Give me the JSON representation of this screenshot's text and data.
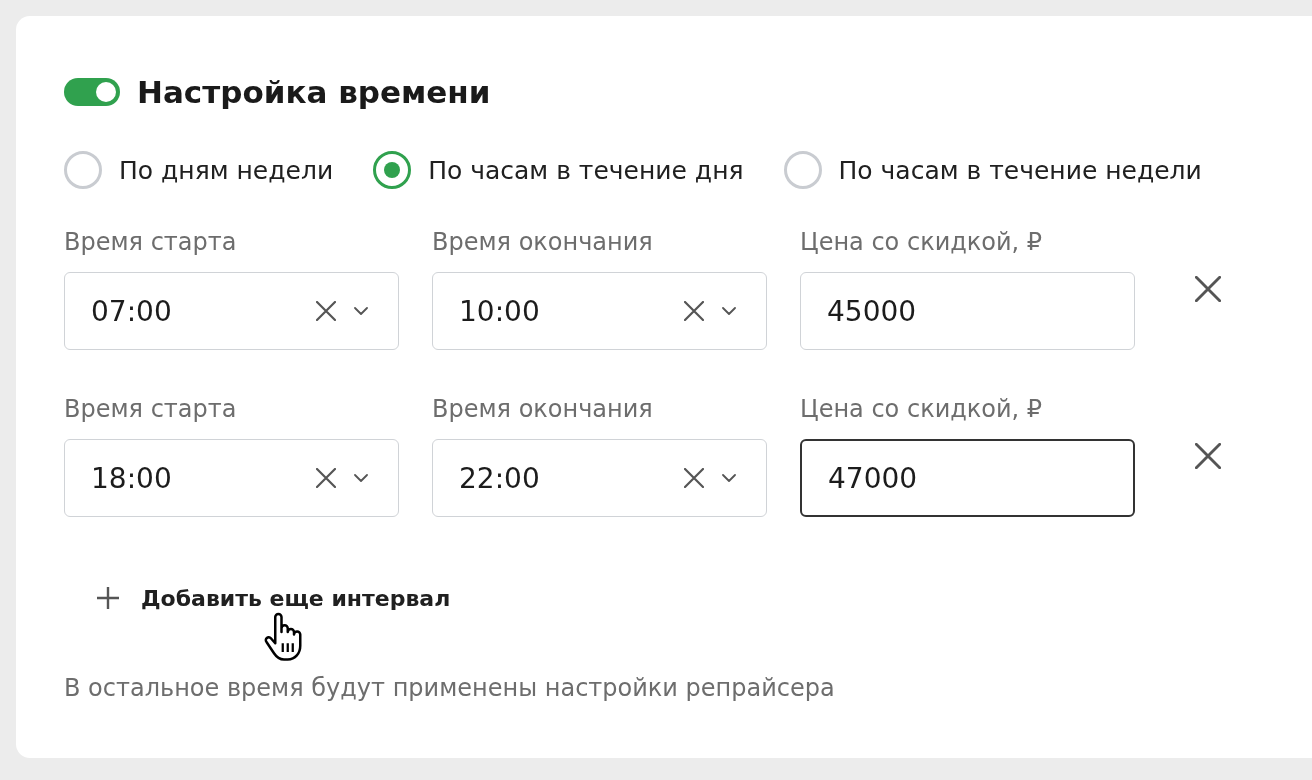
{
  "section": {
    "title": "Настройка времени",
    "enabled": true
  },
  "modes": [
    {
      "label": "По дням недели",
      "selected": false
    },
    {
      "label": "По часам в течение дня",
      "selected": true
    },
    {
      "label": "По часам в течение недели",
      "selected": false
    }
  ],
  "intervals": [
    {
      "fields": [
        {
          "kind": "select",
          "label": "Время старта",
          "value": "07:00",
          "focused": false
        },
        {
          "kind": "select",
          "label": "Время окончания",
          "value": "10:00",
          "focused": false
        },
        {
          "kind": "input",
          "label": "Цена со скидкой, ₽",
          "value": "45000",
          "focused": false
        }
      ]
    },
    {
      "fields": [
        {
          "kind": "select",
          "label": "Время старта",
          "value": "18:00",
          "focused": false
        },
        {
          "kind": "select",
          "label": "Время окончания",
          "value": "22:00",
          "focused": false
        },
        {
          "kind": "input",
          "label": "Цена со скидкой, ₽",
          "value": "47000",
          "focused": true
        }
      ]
    }
  ],
  "add_button": {
    "label": "Добавить еще интервал"
  },
  "note": "В остальное время будут применены настройки репрайсера"
}
